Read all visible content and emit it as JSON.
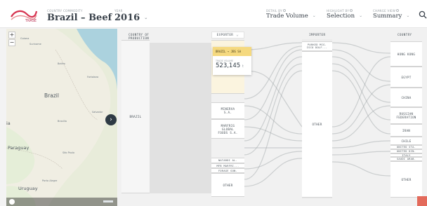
{
  "header": {
    "logo_label": "TRASE",
    "commodity_small": "COUNTRY   COMMODITY",
    "commodity_value": "Brazil – Beef",
    "year_small": "YEAR",
    "year_value": "2016",
    "unit_small": "DETAIL BY",
    "unit_value": "Trade Volume",
    "selection_small": "HIGHLIGHT BY",
    "selection_value": "Selection",
    "view_small": "CHANGE VIEW",
    "view_value": "Summary",
    "search_icon": "search-icon"
  },
  "map": {
    "labels": {
      "guiana": "Guiana",
      "suriname": "Suriname",
      "belem": "Belém",
      "fortaleza": "Fortaleza",
      "brasilia": "Brasília",
      "salvador": "Salvador",
      "sao_paulo": "São Paulo",
      "porto_alegre": "Porto Alegre"
    },
    "countries": {
      "brazil": "Brazil",
      "bolivia": "ia",
      "paraguay": "Paraguay",
      "uruguay": "Uruguay"
    },
    "zoom_in": "+",
    "zoom_out": "−",
    "toggle": "›"
  },
  "sankey": {
    "headers": {
      "country_of_production": "COUNTRY OF\nPRODUCTION",
      "exporter": "EXPORTER",
      "importer": "IMPORTER",
      "country": "COUNTRY"
    },
    "production": [
      {
        "label": "BRAZIL"
      }
    ],
    "exporters": [
      {
        "label": "MINERVA\nS.A."
      },
      {
        "label": "MARFRIG\nGLOBAL\nFOODS S.A."
      },
      {
        "label": "NATARDI AL."
      },
      {
        "label": "MFB MARFRI..."
      },
      {
        "label": "FORAGE GON."
      },
      {
        "label": "OTHER"
      }
    ],
    "importers": [
      {
        "label": "PARKED MIG.\nISCO DOLF..."
      },
      {
        "label": "OTHER"
      }
    ],
    "countries": [
      {
        "label": "HONG KONG"
      },
      {
        "label": "EGYPT"
      },
      {
        "label": "CHINA"
      },
      {
        "label": "RUSSIAN\nFEDERATION"
      },
      {
        "label": "IRAN"
      },
      {
        "label": "CHILE"
      },
      {
        "label": "UNITED STA."
      },
      {
        "label": "UNITED KIN."
      },
      {
        "label": "ITALY"
      },
      {
        "label": "SAUDI ARAB."
      },
      {
        "label": "OTHER"
      }
    ],
    "tooltip": {
      "title": "BRAZIL → JBS SA",
      "label": "TRADE VOLUME",
      "value": "523,145",
      "unit": "t"
    }
  },
  "colors": {
    "accent": "#f5d97f",
    "brand": "#d6324f",
    "dark": "#2e3a44",
    "corner": "#e36a5b"
  }
}
